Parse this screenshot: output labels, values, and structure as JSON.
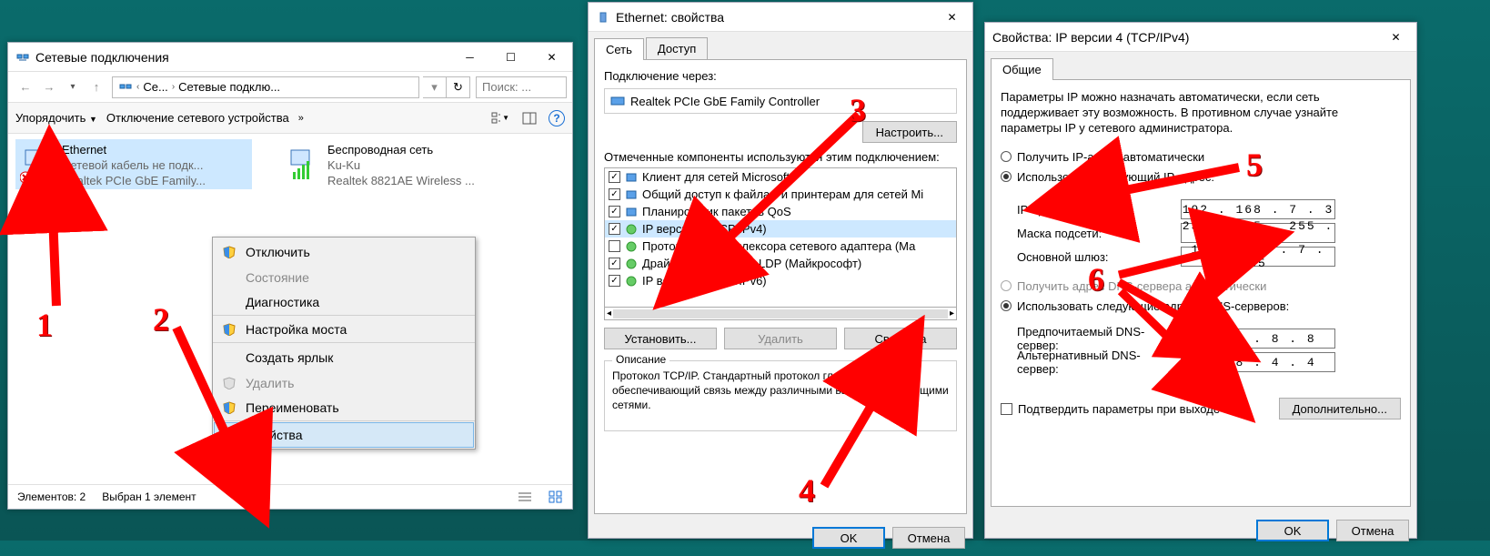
{
  "explorer": {
    "title": "Сетевые подключения",
    "crumb1": "Се...",
    "crumb2": "Сетевые подклю...",
    "search_placeholder": "Поиск: ...",
    "organize": "Упорядочить",
    "disable": "Отключение сетевого устройства",
    "ethernet": {
      "name": "Ethernet",
      "status": "Сетевой кабель не подк...",
      "adapter": "Realtek PCIe GbE Family..."
    },
    "wifi": {
      "name": "Беспроводная сеть",
      "status": "Ku-Ku",
      "adapter": "Realtek 8821AE Wireless ..."
    },
    "status_count": "Элементов: 2",
    "status_sel": "Выбран 1 элемент"
  },
  "context_menu": {
    "items": [
      {
        "label": "Отключить",
        "shield": true,
        "disabled": false
      },
      {
        "label": "Состояние",
        "shield": false,
        "disabled": true
      },
      {
        "label": "Диагностика",
        "shield": false,
        "disabled": false,
        "sep": true
      },
      {
        "label": "Настройка моста",
        "shield": true,
        "disabled": false,
        "sep": true
      },
      {
        "label": "Создать ярлык",
        "shield": false,
        "disabled": false
      },
      {
        "label": "Удалить",
        "shield": true,
        "disabled": true
      },
      {
        "label": "Переименовать",
        "shield": true,
        "disabled": false,
        "sep": true
      },
      {
        "label": "Свойства",
        "shield": true,
        "disabled": false,
        "highlight": true
      }
    ]
  },
  "eth_props": {
    "title": "Ethernet: свойства",
    "tab_net": "Сеть",
    "tab_access": "Доступ",
    "conn_through": "Подключение через:",
    "adapter": "Realtek PCIe GbE Family Controller",
    "configure": "Настроить...",
    "components_label": "Отмеченные компоненты используются этим подключением:",
    "components": [
      "Клиент для сетей Microsoft",
      "Общий доступ к файлам и принтерам для сетей Mi",
      "Планировщик пакетов QoS",
      "IP версии 4 (TCP/IPv4)",
      "Протокол мультиплексора сетевого адаптера (Ма",
      "Драйвер протокола LLDP (Майкрософт)",
      "IP версии 6 (TCP/IPv6)"
    ],
    "install": "Установить...",
    "remove": "Удалить",
    "properties": "Свойства",
    "desc_label": "Описание",
    "desc_text": "Протокол TCP/IP. Стандартный протокол глобальных сетей, обеспечивающий связь между различными взаимодействующими сетями.",
    "ok": "OK",
    "cancel": "Отмена"
  },
  "ipv4": {
    "title": "Свойства: IP версии 4 (TCP/IPv4)",
    "tab": "Общие",
    "intro": "Параметры IP можно назначать автоматически, если сеть поддерживает эту возможность. В противном случае узнайте параметры IP у сетевого администратора.",
    "radio_auto_ip": "Получить IP-адрес автоматически",
    "radio_man_ip": "Использовать следующий IP-адрес:",
    "ip_label": "IP-адрес:",
    "ip": "192 . 168 .  7  .  3",
    "mask_label": "Маска подсети:",
    "mask": "255 . 255 . 255 .  0",
    "gw_label": "Основной шлюз:",
    "gw": "192 . 168 .  7  . 35",
    "radio_auto_dns": "Получить адрес DNS-сервера автоматически",
    "radio_man_dns": "Использовать следующие адреса DNS-серверов:",
    "dns1_label": "Предпочитаемый DNS-сервер:",
    "dns1": "8  .  8  .  8  .  8",
    "dns2_label": "Альтернативный DNS-сервер:",
    "dns2": "8  .  8  .  4  .  4",
    "confirm": "Подтвердить параметры при выходе",
    "advanced": "Дополнительно...",
    "ok": "OK",
    "cancel": "Отмена"
  },
  "annotations": {
    "n1": "1",
    "n2": "2",
    "n3": "3",
    "n4": "4",
    "n5": "5",
    "n6": "6"
  }
}
